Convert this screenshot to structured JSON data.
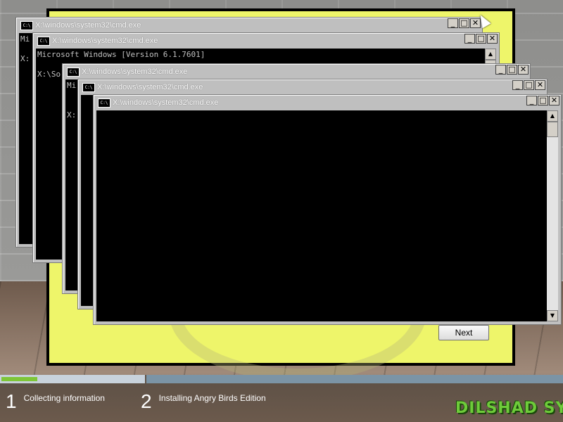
{
  "setup": {
    "next_label": "Next"
  },
  "cmd_windows": [
    {
      "title": "X:\\windows\\system32\\cmd.exe",
      "lines": "Mi\n\nX:"
    },
    {
      "title": "X:\\windows\\system32\\cmd.exe",
      "lines": "Microsoft Windows [Version 6.1.7601]\n\nX:\\So"
    },
    {
      "title": "X:\\windows\\system32\\cmd.exe",
      "lines": "Mi\n\n\nX:"
    },
    {
      "title": "X:\\windows\\system32\\cmd.exe",
      "lines": ""
    },
    {
      "title": "X:\\windows\\system32\\cmd.exe",
      "lines": ""
    }
  ],
  "window_controls": {
    "minimize": "_",
    "maximize": "□",
    "close": "✕"
  },
  "progress": {
    "step1_fraction": 0.25
  },
  "steps": [
    {
      "num": "1",
      "label": "Collecting information"
    },
    {
      "num": "2",
      "label": "Installing Angry Birds Edition"
    }
  ],
  "watermark": "DILSHAD SYS",
  "colors": {
    "setup_bg": "#eef56a",
    "progress_fill": "#7ec638",
    "watermark": "#6ecb3a"
  }
}
